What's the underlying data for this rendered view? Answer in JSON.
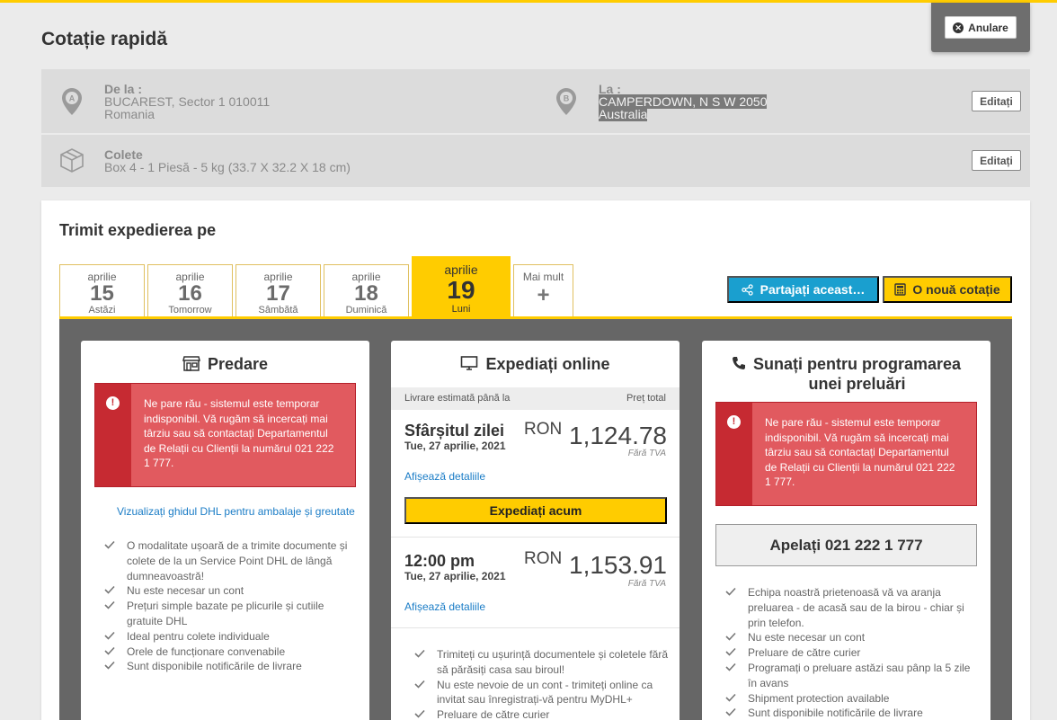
{
  "header": {
    "title": "Cotație rapidă",
    "cancel_label": "Anulare"
  },
  "route": {
    "from_label": "De la :",
    "from_line1": "BUCAREST, Sector 1 010011",
    "from_line2": "Romania",
    "to_label": "La :",
    "to_line1": "CAMPERDOWN, N S W 2050",
    "to_line2": "Australia",
    "edit_label": "Editați"
  },
  "package": {
    "label": "Colete",
    "detail": "Box 4 - 1 Piesă - 5 kg (33.7 X 32.2 X 18 cm)",
    "edit_label": "Editați"
  },
  "shipping": {
    "title": "Trimit expedierea pe",
    "dates": [
      {
        "month": "aprilie",
        "day": "15",
        "sub": "Astăzi"
      },
      {
        "month": "aprilie",
        "day": "16",
        "sub": "Tomorrow"
      },
      {
        "month": "aprilie",
        "day": "17",
        "sub": "Sâmbătă"
      },
      {
        "month": "aprilie",
        "day": "18",
        "sub": "Duminică"
      },
      {
        "month": "aprilie",
        "day": "19",
        "sub": "Luni"
      }
    ],
    "more_label": "Mai mult",
    "more_symbol": "+",
    "share_label": "Partajați aceast…",
    "new_quote_label": "O nouă cotație"
  },
  "error_message": "Ne pare rău - sistemul este temporar indisponibil. Vă rugăm să incercați mai târziu sau să contactați Departamentul de Relații cu Clienții la numărul 021 222 1 777.",
  "options": {
    "dropoff": {
      "title": "Predare",
      "guide_link": "Vizualizați ghidul DHL pentru ambalaje și greutate",
      "features": [
        "O modalitate ușoară de a trimite documente și colete de la un Service Point DHL de lângă dumneavoastră!",
        "Nu este necesar un cont",
        "Prețuri simple bazate pe plicurile și cutiile gratuite DHL",
        "Ideal pentru colete individuale",
        "Orele de funcționare convenabile",
        "Sunt disponibile notificările de livrare"
      ]
    },
    "online": {
      "title": "Expediați online",
      "col_left": "Livrare estimată până la",
      "col_right": "Preț total",
      "tiers": [
        {
          "time": "Sfârșitul zilei",
          "date": "Tue, 27 aprilie, 2021",
          "currency": "RON",
          "price": "1,124.78",
          "vat": "Fără TVA",
          "details": "Afișează detaliile"
        },
        {
          "time": "12:00 pm",
          "date": "Tue, 27 aprilie, 2021",
          "currency": "RON",
          "price": "1,153.91",
          "vat": "Fără TVA",
          "details": "Afișează detaliile"
        }
      ],
      "ship_now": "Expediați acum",
      "features": [
        "Trimiteți cu ușurință documentele și coletele fără să părăsiți casa sau biroul!",
        "Nu este nevoie de un cont - trimiteți online ca invitat sau înregistrați-vă pentru MyDHL+",
        "Preluare de către curier"
      ]
    },
    "call": {
      "title_line1": "Sunați pentru programarea",
      "title_line2": "unei preluări",
      "call_button": "Apelați 021 222 1 777",
      "features": [
        "Echipa noastră prietenoasă vă va aranja preluarea - de acasă sau de la birou - chiar și prin telefon.",
        "Nu este necesar un cont",
        "Preluare de către curier",
        "Programați o preluare astăzi sau pânp la 5 zile în avans",
        "Shipment protection available",
        "Sunt disponibile notificările de livrare"
      ]
    }
  },
  "colors": {
    "accent": "#ffcc00",
    "share": "#1a9fcf",
    "error": "#e15a5f",
    "error_dark": "#c62a32",
    "link": "#1a7cc6"
  }
}
